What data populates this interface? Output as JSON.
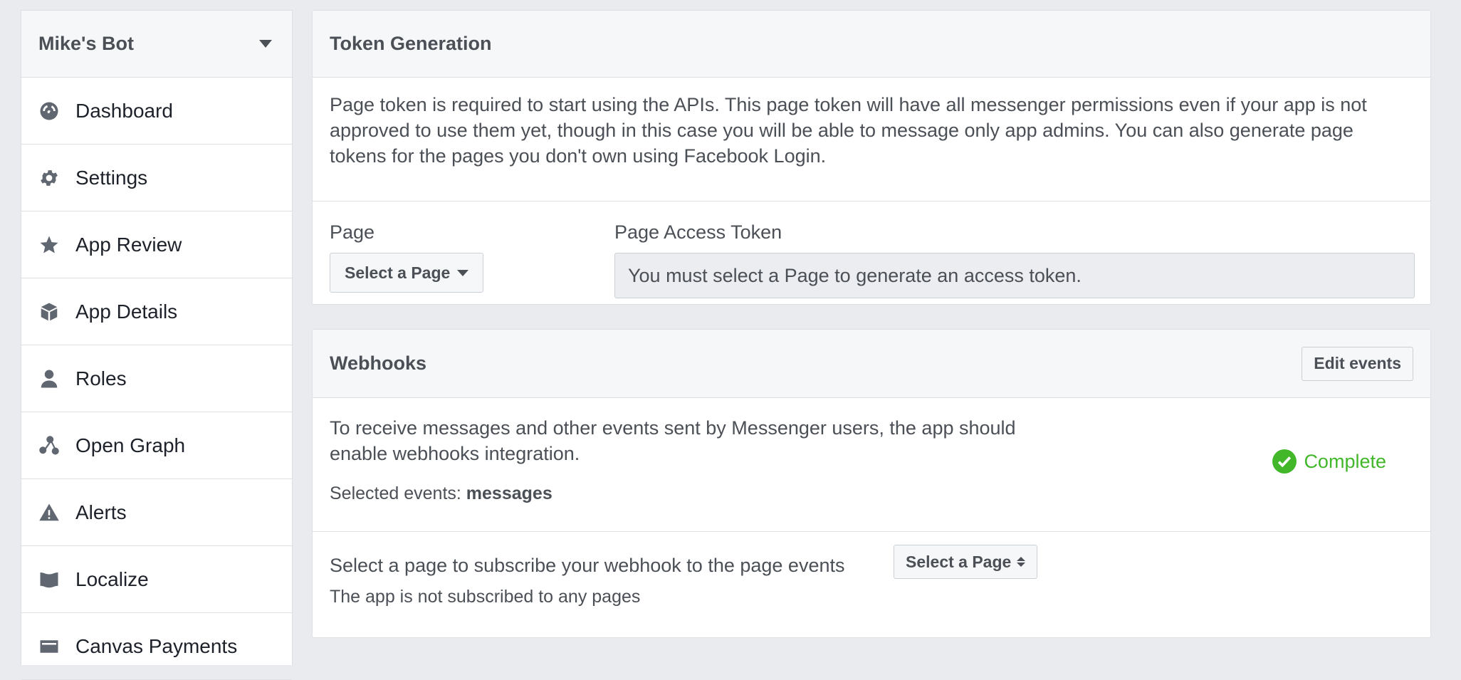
{
  "sidebar": {
    "app_name": "Mike's Bot",
    "items": [
      {
        "label": "Dashboard",
        "icon": "dashboard-icon"
      },
      {
        "label": "Settings",
        "icon": "gear-icon"
      },
      {
        "label": "App Review",
        "icon": "star-icon"
      },
      {
        "label": "App Details",
        "icon": "box-icon"
      },
      {
        "label": "Roles",
        "icon": "person-icon"
      },
      {
        "label": "Open Graph",
        "icon": "graph-icon"
      },
      {
        "label": "Alerts",
        "icon": "warning-icon"
      },
      {
        "label": "Localize",
        "icon": "flag-icon"
      },
      {
        "label": "Canvas Payments",
        "icon": "card-icon"
      }
    ]
  },
  "token": {
    "title": "Token Generation",
    "description": "Page token is required to start using the APIs. This page token will have all messenger permissions even if your app is not approved to use them yet, though in this case you will be able to message only app admins. You can also generate page tokens for the pages you don't own using Facebook Login.",
    "page_label": "Page",
    "page_select": "Select a Page",
    "access_label": "Page Access Token",
    "access_placeholder": "You must select a Page to generate an access token."
  },
  "webhooks": {
    "title": "Webhooks",
    "edit_button": "Edit events",
    "description": "To receive messages and other events sent by Messenger users, the app should enable webhooks integration.",
    "selected_prefix": "Selected events: ",
    "selected_value": "messages",
    "status": "Complete",
    "subscribe_text": "Select a page to subscribe your webhook to the page events",
    "subscribe_select": "Select a Page",
    "subscribe_status": "The app is not subscribed to any pages"
  },
  "colors": {
    "background": "#e9ebee",
    "success": "#42b72a",
    "text_secondary": "#4b4f56"
  }
}
